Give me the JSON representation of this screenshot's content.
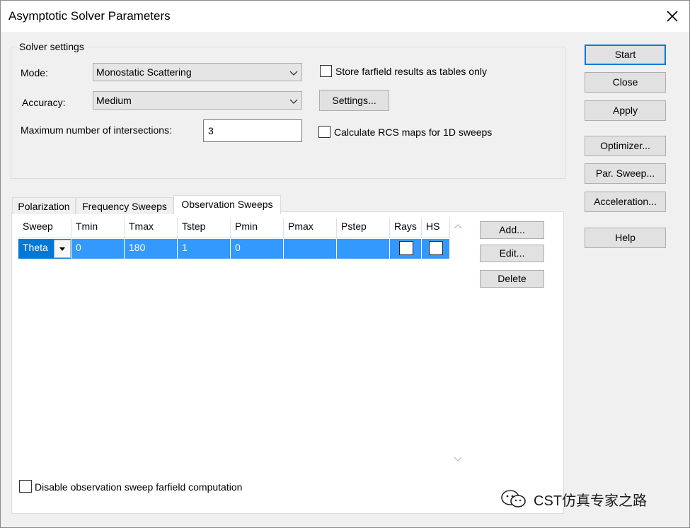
{
  "window": {
    "title": "Asymptotic Solver Parameters"
  },
  "solver_settings": {
    "group_title": "Solver settings",
    "mode_label": "Mode:",
    "mode_value": "Monostatic Scattering",
    "accuracy_label": "Accuracy:",
    "accuracy_value": "Medium",
    "max_intersections_label": "Maximum number of intersections:",
    "max_intersections_value": "3",
    "store_farfield_label": "Store farfield results as tables only",
    "store_farfield_checked": false,
    "settings_button": "Settings...",
    "rcs_maps_label": "Calculate RCS maps for 1D sweeps",
    "rcs_maps_checked": false
  },
  "side_buttons": {
    "start": "Start",
    "close": "Close",
    "apply": "Apply",
    "optimizer": "Optimizer...",
    "par_sweep": "Par. Sweep...",
    "acceleration": "Acceleration...",
    "help": "Help"
  },
  "tabs": [
    {
      "label": "Polarization",
      "active": false
    },
    {
      "label": "Frequency Sweeps",
      "active": false
    },
    {
      "label": "Observation Sweeps",
      "active": true
    }
  ],
  "grid": {
    "columns": [
      "Sweep",
      "Tmin",
      "Tmax",
      "Tstep",
      "Pmin",
      "Pmax",
      "Pstep",
      "Rays",
      "HS"
    ],
    "rows": [
      {
        "sweep": "Theta",
        "tmin": "0",
        "tmax": "180",
        "tstep": "1",
        "pmin": "0",
        "pmax": "",
        "pstep": "",
        "rays": false,
        "hs": false
      }
    ]
  },
  "grid_buttons": {
    "add": "Add...",
    "edit": "Edit...",
    "delete": "Delete"
  },
  "disable_farfield_label": "Disable observation sweep farfield computation",
  "disable_farfield_checked": false,
  "watermark": "CST仿真专家之路",
  "icons": {
    "close": "close-icon",
    "dropdown": "chevron-down-icon",
    "scroll_up": "chevron-up-icon",
    "scroll_down": "chevron-down-icon",
    "watermark": "wechat-icon"
  },
  "colors": {
    "selection": "#3399ff",
    "selection_focus": "#0078d7",
    "default_button_border": "#0078d7"
  }
}
